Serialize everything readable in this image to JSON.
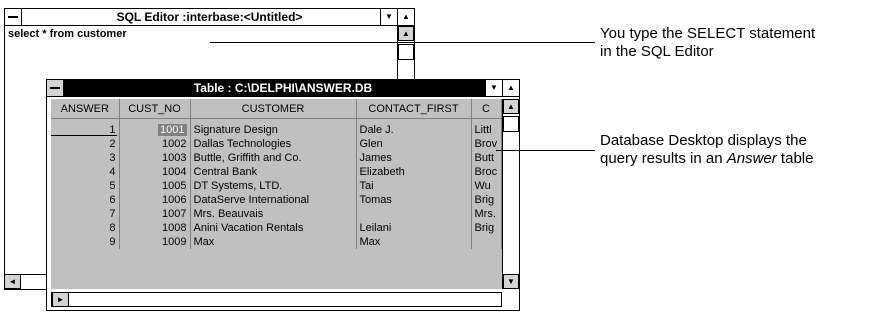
{
  "sql_editor": {
    "title": "SQL Editor  :interbase:<Untitled>",
    "query": "select * from customer",
    "scroll_left_arrow": "◄",
    "scroll_up_arrow": "▲",
    "scroll_down_arrow": "▼"
  },
  "table_window": {
    "title": "Table : C:\\DELPHI\\ANSWER.DB",
    "columns": [
      "ANSWER",
      "CUST_NO",
      "CUSTOMER",
      "CONTACT_FIRST",
      "C"
    ],
    "rows": [
      [
        "1",
        "1001",
        "Signature Design",
        "Dale J.",
        "Littl"
      ],
      [
        "2",
        "1002",
        "Dallas Technologies",
        "Glen",
        "Brov"
      ],
      [
        "3",
        "1003",
        "Buttle, Griffith and Co.",
        "James",
        "Butt"
      ],
      [
        "4",
        "1004",
        "Central Bank",
        "Elizabeth",
        "Broc"
      ],
      [
        "5",
        "1005",
        "DT Systems, LTD.",
        "Tai",
        "Wu"
      ],
      [
        "6",
        "1006",
        "DataServe International",
        "Tomas",
        "Brig"
      ],
      [
        "7",
        "1007",
        "Mrs. Beauvais",
        "",
        "Mrs."
      ],
      [
        "8",
        "1008",
        "Anini Vacation Rentals",
        "Leilani",
        "Brig"
      ],
      [
        "9",
        "1009",
        "Max",
        "Max",
        ""
      ]
    ],
    "scroll_left_arrow": "◄",
    "scroll_right_arrow": "►",
    "scroll_up_arrow": "▲",
    "scroll_down_arrow": "▼"
  },
  "callouts": {
    "sql": [
      "You type the SELECT statement",
      "in the SQL Editor"
    ],
    "answer_line1": "Database Desktop displays the",
    "answer_line2_prefix": "query results in an ",
    "answer_line2_italic": "Answer",
    "answer_line2_suffix": " table"
  }
}
